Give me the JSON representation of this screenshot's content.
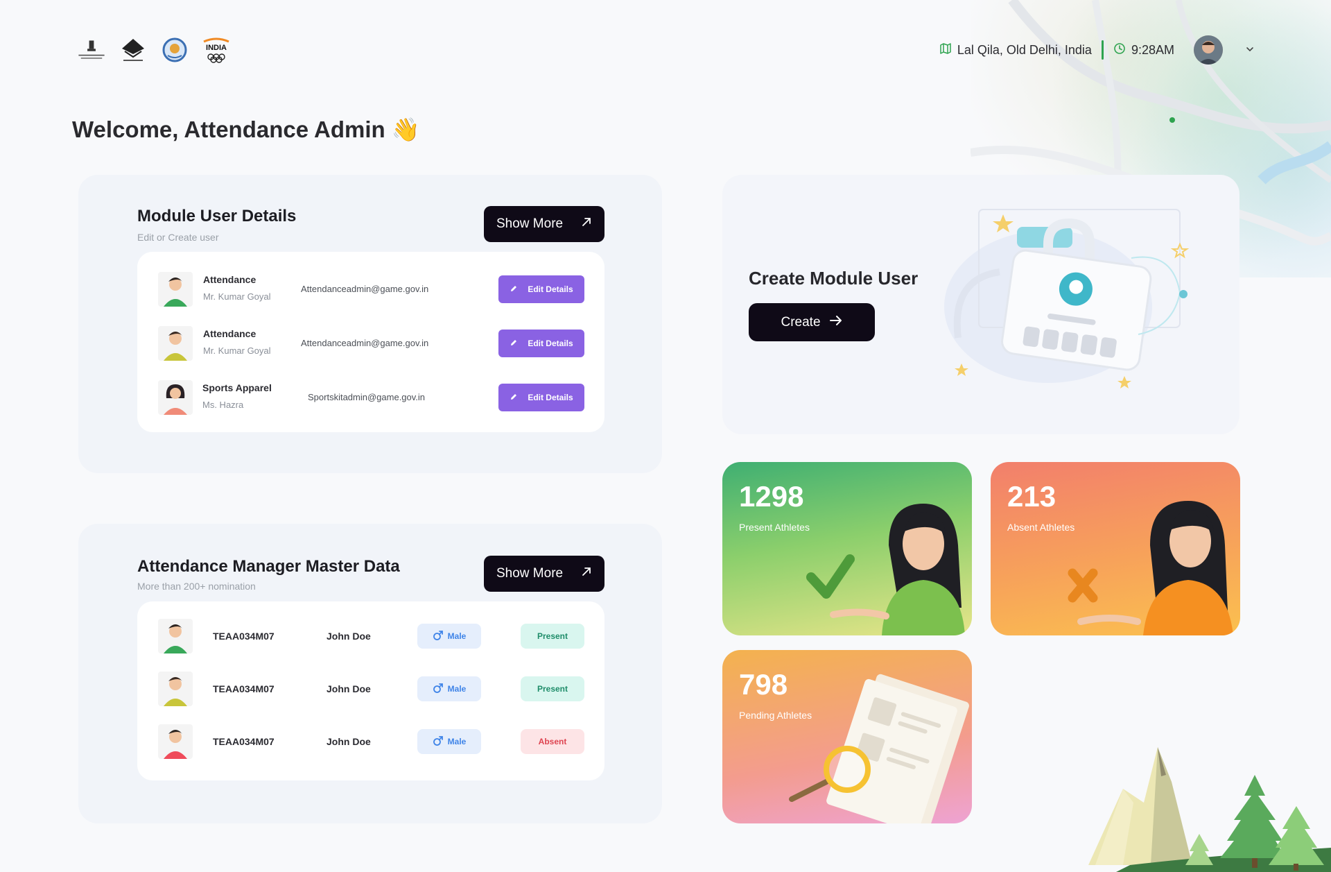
{
  "header": {
    "logos": [
      "ministry-emblem",
      "ministry-logo",
      "sai-logo",
      "india-olympic-logo"
    ],
    "location": "Lal Qila, Old Delhi, India",
    "time": "9:28AM"
  },
  "welcome": {
    "text": "Welcome, Attendance Admin",
    "emoji": "👋"
  },
  "module_users": {
    "title": "Module User Details",
    "subtitle": "Edit or Create user",
    "show_more_label": "Show More",
    "edit_label": "Edit Details",
    "rows": [
      {
        "name": "Attendance",
        "subname": "Mr. Kumar Goyal",
        "email": "Attendanceadmin@game.gov.in"
      },
      {
        "name": "Attendance",
        "subname": "Mr. Kumar Goyal",
        "email": "Attendanceadmin@game.gov.in"
      },
      {
        "name": "Sports Apparel",
        "subname": "Ms. Hazra",
        "email": "Sportskitadmin@game.gov.in"
      }
    ]
  },
  "master_data": {
    "title": "Attendance Manager Master Data",
    "subtitle": "More than 200+ nomination",
    "show_more_label": "Show More",
    "rows": [
      {
        "code": "TEAA034M07",
        "name": "John Doe",
        "gender": "Male",
        "status": "Present"
      },
      {
        "code": "TEAA034M07",
        "name": "John Doe",
        "gender": "Male",
        "status": "Present"
      },
      {
        "code": "TEAA034M07",
        "name": "John Doe",
        "gender": "Male",
        "status": "Absent"
      }
    ]
  },
  "create_module": {
    "title": "Create Module User",
    "button_label": "Create"
  },
  "stats": {
    "present": {
      "value": "1298",
      "label": "Present Athletes"
    },
    "absent": {
      "value": "213",
      "label": "Absent Athletes"
    },
    "pending": {
      "value": "798",
      "label": "Pending Athletes"
    }
  },
  "colors": {
    "accent_dark": "#0f0a17",
    "edit_purple": "#8a62e3",
    "present_green": "#1f8d6a",
    "absent_red": "#de4451",
    "male_blue": "#3f84e8"
  }
}
